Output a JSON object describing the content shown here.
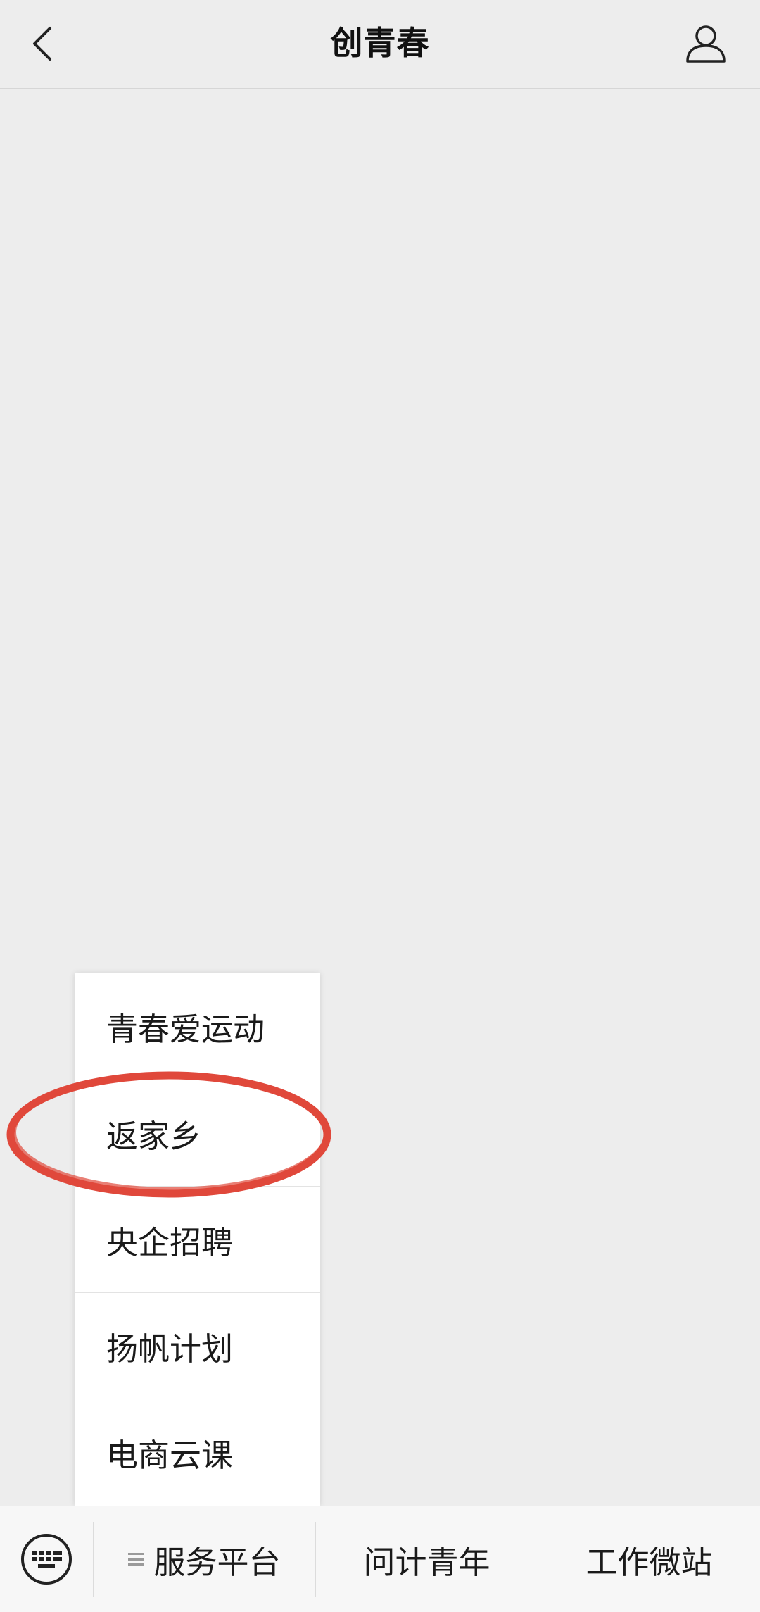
{
  "header": {
    "title": "创青春"
  },
  "submenu": {
    "items": [
      {
        "label": "青春爱运动"
      },
      {
        "label": "返家乡"
      },
      {
        "label": "央企招聘"
      },
      {
        "label": "扬帆计划"
      },
      {
        "label": "电商云课"
      }
    ],
    "highlighted_item": "返家乡"
  },
  "bottom_menu": {
    "tabs": [
      {
        "label": "服务平台",
        "has_list_icon": true
      },
      {
        "label": "问计青年"
      },
      {
        "label": "工作微站"
      }
    ]
  },
  "icons": {
    "back": "chevron-left-icon",
    "profile": "person-icon",
    "keyboard": "keyboard-icon",
    "submenu_indicator": "list-icon"
  },
  "colors": {
    "background": "#ededed",
    "highlight_ring": "#e0483b",
    "menu_bg": "#ffffff",
    "bottom_bar_bg": "#f7f7f7"
  }
}
